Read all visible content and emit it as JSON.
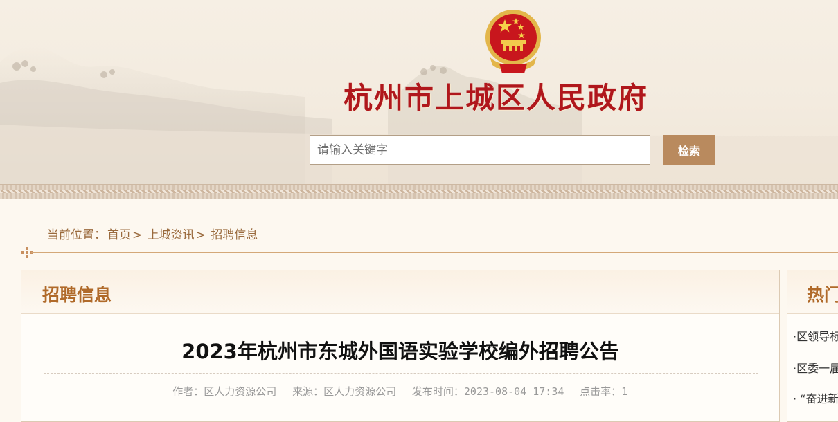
{
  "header": {
    "site_title": "杭州市上城区人民政府",
    "search_placeholder": "请输入关键字",
    "search_button": "检索"
  },
  "breadcrumb": {
    "prefix": "当前位置：",
    "items": [
      "首页",
      "上城资讯",
      "招聘信息"
    ],
    "separator": ">"
  },
  "main": {
    "section_title": "招聘信息",
    "article_title": "2023年杭州市东城外国语实验学校编外招聘公告",
    "meta": {
      "author_label": "作者：",
      "author": "区人力资源公司",
      "source_label": "来源：",
      "source": "区人力资源公司",
      "time_label": "发布时间：",
      "time": "2023-08-04 17:34",
      "clicks_label": "点击率：",
      "clicks": "1"
    }
  },
  "side": {
    "title": "热门",
    "items": [
      "·区领导标",
      "·区委一届",
      "· “奋进新"
    ]
  },
  "colors": {
    "title_red": "#b0171c",
    "accent_brown": "#b06a2a",
    "button_brown": "#b98a5e",
    "breadcrumb_brown": "#9a6a3d",
    "divider_gold": "#d4a878"
  }
}
